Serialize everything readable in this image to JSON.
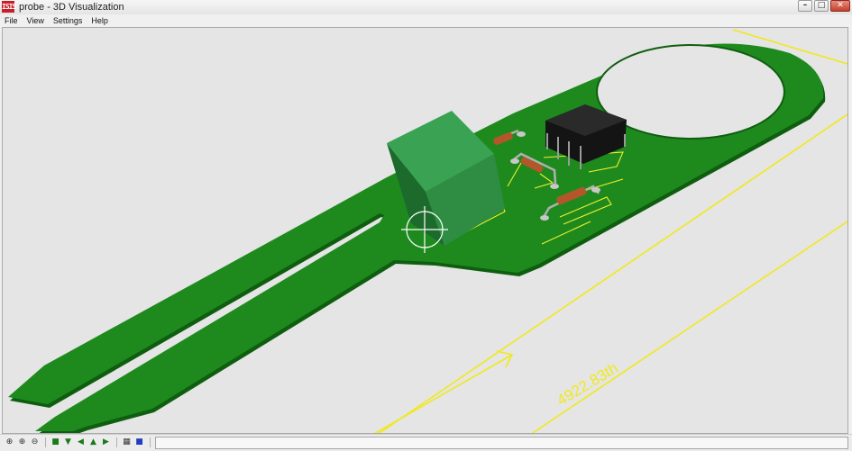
{
  "window": {
    "title": "probe - 3D Visualization",
    "app_icon_text": "ISIS",
    "minimize_glyph": "–",
    "maximize_glyph": "□",
    "close_glyph": "✕"
  },
  "menu": {
    "items": [
      "File",
      "View",
      "Settings",
      "Help"
    ]
  },
  "scene": {
    "dimension_label": "4922.83th",
    "colors": {
      "background": "#e5e5e5",
      "board": "#1e8a1e",
      "board_edge": "#0f5e10",
      "dimension": "#f0e81e",
      "silkscreen": "#f4ef2a",
      "pad": "#c8c8c8",
      "ic_body": "#141414",
      "relay_body": "#2f8d43",
      "resistor": "#b5562a"
    }
  },
  "toolbar": {
    "icons": [
      "pan-icon",
      "zoom-in-icon",
      "zoom-out-icon",
      "view-top-icon",
      "view-bottom-icon",
      "view-left-icon",
      "view-front-icon",
      "view-right-icon",
      "view-fit-icon",
      "color-select-icon"
    ]
  },
  "status": {
    "text": ""
  }
}
